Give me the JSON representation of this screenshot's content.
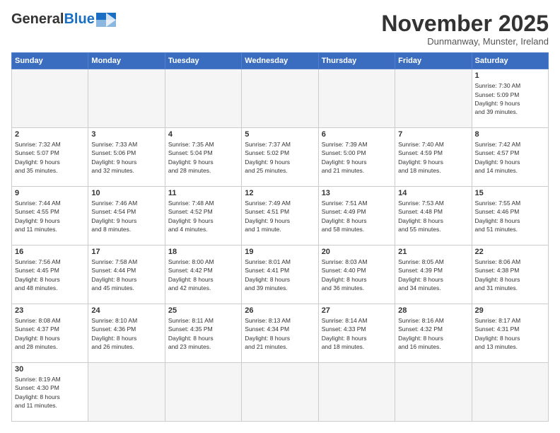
{
  "header": {
    "logo_general": "General",
    "logo_blue": "Blue",
    "month_title": "November 2025",
    "location": "Dunmanway, Munster, Ireland"
  },
  "days_of_week": [
    "Sunday",
    "Monday",
    "Tuesday",
    "Wednesday",
    "Thursday",
    "Friday",
    "Saturday"
  ],
  "weeks": [
    [
      {
        "day": "",
        "info": ""
      },
      {
        "day": "",
        "info": ""
      },
      {
        "day": "",
        "info": ""
      },
      {
        "day": "",
        "info": ""
      },
      {
        "day": "",
        "info": ""
      },
      {
        "day": "",
        "info": ""
      },
      {
        "day": "1",
        "info": "Sunrise: 7:30 AM\nSunset: 5:09 PM\nDaylight: 9 hours\nand 39 minutes."
      }
    ],
    [
      {
        "day": "2",
        "info": "Sunrise: 7:32 AM\nSunset: 5:07 PM\nDaylight: 9 hours\nand 35 minutes."
      },
      {
        "day": "3",
        "info": "Sunrise: 7:33 AM\nSunset: 5:06 PM\nDaylight: 9 hours\nand 32 minutes."
      },
      {
        "day": "4",
        "info": "Sunrise: 7:35 AM\nSunset: 5:04 PM\nDaylight: 9 hours\nand 28 minutes."
      },
      {
        "day": "5",
        "info": "Sunrise: 7:37 AM\nSunset: 5:02 PM\nDaylight: 9 hours\nand 25 minutes."
      },
      {
        "day": "6",
        "info": "Sunrise: 7:39 AM\nSunset: 5:00 PM\nDaylight: 9 hours\nand 21 minutes."
      },
      {
        "day": "7",
        "info": "Sunrise: 7:40 AM\nSunset: 4:59 PM\nDaylight: 9 hours\nand 18 minutes."
      },
      {
        "day": "8",
        "info": "Sunrise: 7:42 AM\nSunset: 4:57 PM\nDaylight: 9 hours\nand 14 minutes."
      }
    ],
    [
      {
        "day": "9",
        "info": "Sunrise: 7:44 AM\nSunset: 4:55 PM\nDaylight: 9 hours\nand 11 minutes."
      },
      {
        "day": "10",
        "info": "Sunrise: 7:46 AM\nSunset: 4:54 PM\nDaylight: 9 hours\nand 8 minutes."
      },
      {
        "day": "11",
        "info": "Sunrise: 7:48 AM\nSunset: 4:52 PM\nDaylight: 9 hours\nand 4 minutes."
      },
      {
        "day": "12",
        "info": "Sunrise: 7:49 AM\nSunset: 4:51 PM\nDaylight: 9 hours\nand 1 minute."
      },
      {
        "day": "13",
        "info": "Sunrise: 7:51 AM\nSunset: 4:49 PM\nDaylight: 8 hours\nand 58 minutes."
      },
      {
        "day": "14",
        "info": "Sunrise: 7:53 AM\nSunset: 4:48 PM\nDaylight: 8 hours\nand 55 minutes."
      },
      {
        "day": "15",
        "info": "Sunrise: 7:55 AM\nSunset: 4:46 PM\nDaylight: 8 hours\nand 51 minutes."
      }
    ],
    [
      {
        "day": "16",
        "info": "Sunrise: 7:56 AM\nSunset: 4:45 PM\nDaylight: 8 hours\nand 48 minutes."
      },
      {
        "day": "17",
        "info": "Sunrise: 7:58 AM\nSunset: 4:44 PM\nDaylight: 8 hours\nand 45 minutes."
      },
      {
        "day": "18",
        "info": "Sunrise: 8:00 AM\nSunset: 4:42 PM\nDaylight: 8 hours\nand 42 minutes."
      },
      {
        "day": "19",
        "info": "Sunrise: 8:01 AM\nSunset: 4:41 PM\nDaylight: 8 hours\nand 39 minutes."
      },
      {
        "day": "20",
        "info": "Sunrise: 8:03 AM\nSunset: 4:40 PM\nDaylight: 8 hours\nand 36 minutes."
      },
      {
        "day": "21",
        "info": "Sunrise: 8:05 AM\nSunset: 4:39 PM\nDaylight: 8 hours\nand 34 minutes."
      },
      {
        "day": "22",
        "info": "Sunrise: 8:06 AM\nSunset: 4:38 PM\nDaylight: 8 hours\nand 31 minutes."
      }
    ],
    [
      {
        "day": "23",
        "info": "Sunrise: 8:08 AM\nSunset: 4:37 PM\nDaylight: 8 hours\nand 28 minutes."
      },
      {
        "day": "24",
        "info": "Sunrise: 8:10 AM\nSunset: 4:36 PM\nDaylight: 8 hours\nand 26 minutes."
      },
      {
        "day": "25",
        "info": "Sunrise: 8:11 AM\nSunset: 4:35 PM\nDaylight: 8 hours\nand 23 minutes."
      },
      {
        "day": "26",
        "info": "Sunrise: 8:13 AM\nSunset: 4:34 PM\nDaylight: 8 hours\nand 21 minutes."
      },
      {
        "day": "27",
        "info": "Sunrise: 8:14 AM\nSunset: 4:33 PM\nDaylight: 8 hours\nand 18 minutes."
      },
      {
        "day": "28",
        "info": "Sunrise: 8:16 AM\nSunset: 4:32 PM\nDaylight: 8 hours\nand 16 minutes."
      },
      {
        "day": "29",
        "info": "Sunrise: 8:17 AM\nSunset: 4:31 PM\nDaylight: 8 hours\nand 13 minutes."
      }
    ],
    [
      {
        "day": "30",
        "info": "Sunrise: 8:19 AM\nSunset: 4:30 PM\nDaylight: 8 hours\nand 11 minutes."
      },
      {
        "day": "",
        "info": ""
      },
      {
        "day": "",
        "info": ""
      },
      {
        "day": "",
        "info": ""
      },
      {
        "day": "",
        "info": ""
      },
      {
        "day": "",
        "info": ""
      },
      {
        "day": "",
        "info": ""
      }
    ]
  ]
}
